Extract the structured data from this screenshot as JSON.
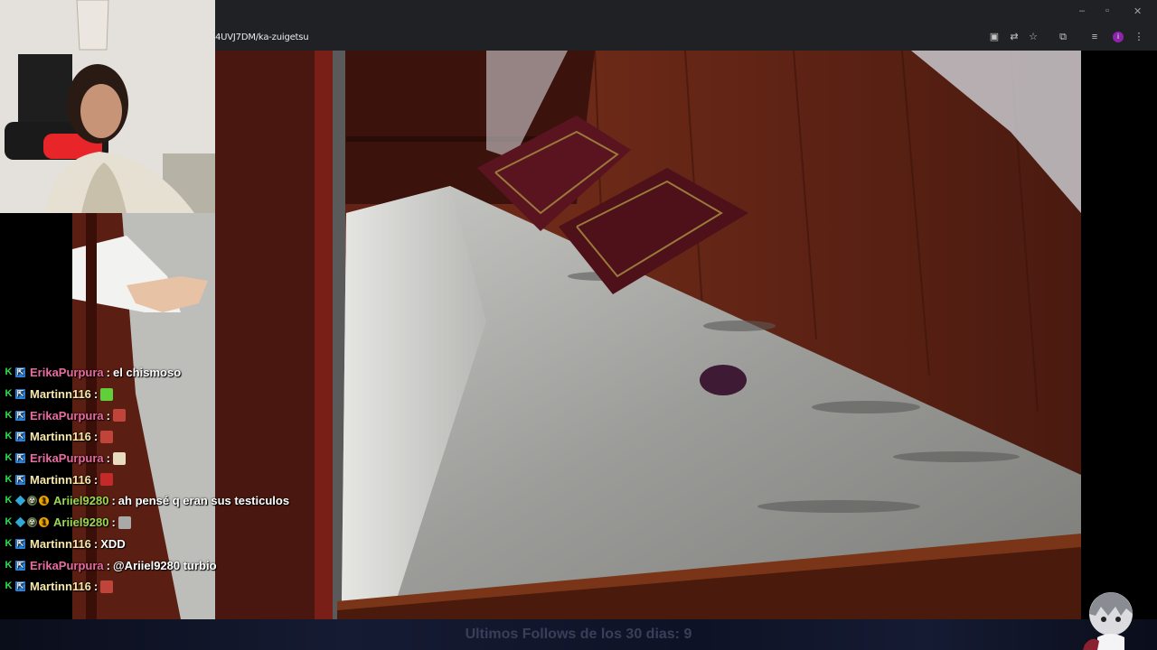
{
  "browser": {
    "url": "4UVJ7DM/ka-zuigetsu",
    "window_controls": [
      "–",
      "▫",
      "✕"
    ]
  },
  "overlay": {
    "follows_text": "Ultimos Follows de los 30 dias: 9"
  },
  "chat": {
    "messages": [
      {
        "user": "ErikaPurpura",
        "color": "#e86ba0",
        "badges": [
          "k",
          "p"
        ],
        "text": "el chismoso",
        "emote": null
      },
      {
        "user": "Martinn116",
        "color": "#f5e8a8",
        "badges": [
          "k",
          "p"
        ],
        "text": "",
        "emote": "green-blob"
      },
      {
        "user": "ErikaPurpura",
        "color": "#e86ba0",
        "badges": [
          "k",
          "p"
        ],
        "text": "",
        "emote": "red-face"
      },
      {
        "user": "Martinn116",
        "color": "#f5e8a8",
        "badges": [
          "k",
          "p"
        ],
        "text": "",
        "emote": "red-face"
      },
      {
        "user": "ErikaPurpura",
        "color": "#e86ba0",
        "badges": [
          "k",
          "p"
        ],
        "text": "",
        "emote": "paper-face"
      },
      {
        "user": "Martinn116",
        "color": "#f5e8a8",
        "badges": [
          "k",
          "p"
        ],
        "text": "",
        "emote": "devil-face"
      },
      {
        "user": "Ariiel9280",
        "color": "#9ad84f",
        "badges": [
          "k",
          "c",
          "n",
          "g"
        ],
        "text": "ah pensé q eran sus testiculos",
        "emote": null
      },
      {
        "user": "Ariiel9280",
        "color": "#9ad84f",
        "badges": [
          "k",
          "c",
          "n",
          "g"
        ],
        "text": "",
        "emote": "grey-cat"
      },
      {
        "user": "Martinn116",
        "color": "#f5e8a8",
        "badges": [
          "k",
          "p"
        ],
        "text": "XDD",
        "emote": null
      },
      {
        "user": "ErikaPurpura",
        "color": "#e86ba0",
        "badges": [
          "k",
          "p"
        ],
        "text": "@Ariiel9280 turbio",
        "emote": null
      },
      {
        "user": "Martinn116",
        "color": "#f5e8a8",
        "badges": [
          "k",
          "p"
        ],
        "text": "",
        "emote": "red-face"
      }
    ],
    "separator": ":"
  }
}
